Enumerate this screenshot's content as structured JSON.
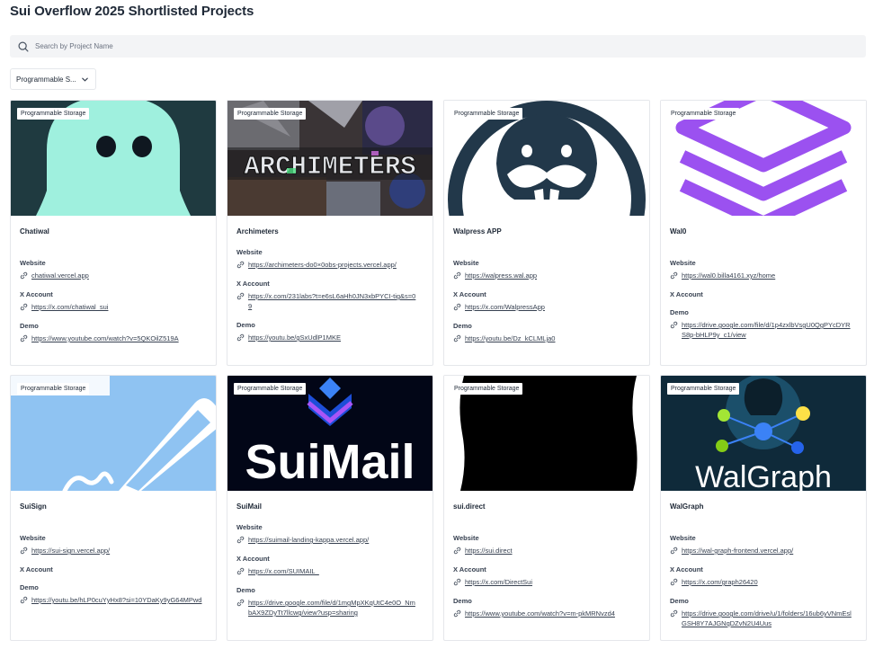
{
  "page": {
    "title": "Sui Overflow 2025 Shortlisted Projects"
  },
  "search": {
    "placeholder": "Search by Project Name"
  },
  "filter": {
    "selected": "Programmable S..."
  },
  "labels": {
    "website": "Website",
    "x_account": "X Account",
    "demo": "Demo"
  },
  "colors": {
    "accent_text": "#1f2937",
    "border": "#e5e7eb",
    "search_bg": "#f3f4f6"
  },
  "cards": [
    {
      "tag": "Programmable Storage",
      "title": "Chatiwal",
      "website": "chatiwal.vercel.app",
      "x_account": "https://x.com/chatiwal_sui",
      "demo": "https://www.youtube.com/watch?v=5QKOilZ519A"
    },
    {
      "tag": "Programmable Storage",
      "title": "Archimeters",
      "image_text": "ARCHIMETERS",
      "website": "https://archimeters-do0×0obs-projects.vercel.app/",
      "x_account": "https://x.com/231labs?t=e6sL6aHh0JN3xbPYCI-tig&s=09",
      "demo": "https://youtu.be/gSxUdlP1MKE"
    },
    {
      "tag": "Programmable Storage",
      "title": "Walpress APP",
      "website": "https://walpress.wal.app",
      "x_account": "https://x.com/WalpressApp",
      "demo": "https://youtu.be/Dz_kCLMLja0"
    },
    {
      "tag": "Programmable Storage",
      "title": "Wal0",
      "website": "https://wal0.billa4161.xyz/home",
      "x_account": "",
      "demo": "https://drive.google.com/file/d/1p4zxlbVsgU0QgPYcDYRS8p-bHLP9y_c1/view"
    },
    {
      "tag": "Programmable Storage",
      "title": "SuiSign",
      "website": "https://sui-sign.vercel.app/",
      "x_account": "",
      "demo": "https://youtu.be/hLP0cuYyHx8?si=10YDaKy9yG64MPwd"
    },
    {
      "tag": "Programmable Storage",
      "title": "SuiMail",
      "image_text": "SuiMail",
      "website": "https://suimail-landing-kappa.vercel.app/",
      "x_account": "https://x.com/SUIMAIL_",
      "demo": "https://drive.google.com/file/d/1mgMpXKqUtC4e0O_NmbAX9ZDyTt7llcwg/view?usp=sharing"
    },
    {
      "tag": "Programmable Storage",
      "title": "sui.direct",
      "website": "https://sui.direct",
      "x_account": "https://x.com/DirectSui",
      "demo": "https://www.youtube.com/watch?v=m-pkMRNvzd4"
    },
    {
      "tag": "Programmable Storage",
      "title": "WalGraph",
      "image_text": "WalGraph",
      "website": "https://wal-graph-frontend.vercel.app/",
      "x_account": "https://x.com/graph26420",
      "demo": "https://drive.google.com/drive/u/1/folders/16ub6yVNmEslGSH8Y7AJGNqDZvN2U4Uus"
    }
  ]
}
